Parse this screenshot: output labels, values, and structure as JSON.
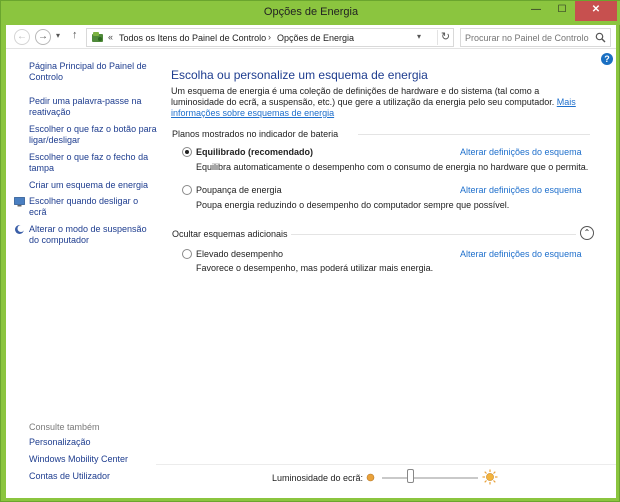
{
  "window": {
    "title": "Opções de Energia",
    "minimize": "—",
    "maximize": "☐",
    "close": "✕"
  },
  "address": {
    "back": "←",
    "forward": "→",
    "recent": "▾",
    "up": "↑",
    "chevron": "«",
    "crumbs": [
      "Todos os Itens do Painel de Controlo",
      "Opções de Energia"
    ],
    "separator": "›",
    "dropdown": "▾",
    "refresh": "↻",
    "search_placeholder": "Procurar no Painel de Controlo"
  },
  "help": "?",
  "sidebar": {
    "items": [
      {
        "label": "Página Principal do Painel de Controlo"
      },
      {
        "label": "Pedir uma palavra-passe na reativação"
      },
      {
        "label": "Escolher o que faz o botão para ligar/desligar"
      },
      {
        "label": "Escolher o que faz o fecho da tampa"
      },
      {
        "label": "Criar um esquema de energia"
      },
      {
        "label": "Escolher quando desligar o ecrã"
      },
      {
        "label": "Alterar o modo de suspensão do computador"
      }
    ],
    "see_also_title": "Consulte também",
    "see_also": [
      {
        "label": "Personalização"
      },
      {
        "label": "Windows Mobility Center"
      },
      {
        "label": "Contas de Utilizador"
      }
    ]
  },
  "main": {
    "title": "Escolha ou personalize um esquema de energia",
    "intro": "Um esquema de energia é uma coleção de definições de hardware e do sistema (tal como a luminosidade do ecrã, a suspensão, etc.) que gere a utilização da energia pelo seu computador.",
    "intro_link": "Mais informações sobre esquemas de energia",
    "section_shown": "Planos mostrados no indicador de bateria",
    "section_hidden": "Ocultar esquemas adicionais",
    "collapse": "⌃",
    "change_link": "Alterar definições do esquema",
    "plans": [
      {
        "name": "Equilibrado (recomendado)",
        "description": "Equilibra automaticamente o desempenho com o consumo de energia no hardware que o permita.",
        "selected": true
      },
      {
        "name": "Poupança de energia",
        "description": "Poupa energia reduzindo o desempenho do computador sempre que possível.",
        "selected": false
      },
      {
        "name": "Elevado desempenho",
        "description": "Favorece o desempenho, mas poderá utilizar mais energia.",
        "selected": false
      }
    ]
  },
  "brightness": {
    "label": "Luminosidade do ecrã:",
    "level_percent": 30
  },
  "colors": {
    "frame": "#8bc53f",
    "link": "#1e6fcc",
    "title": "#1e3d8f",
    "close": "#c7504f"
  }
}
